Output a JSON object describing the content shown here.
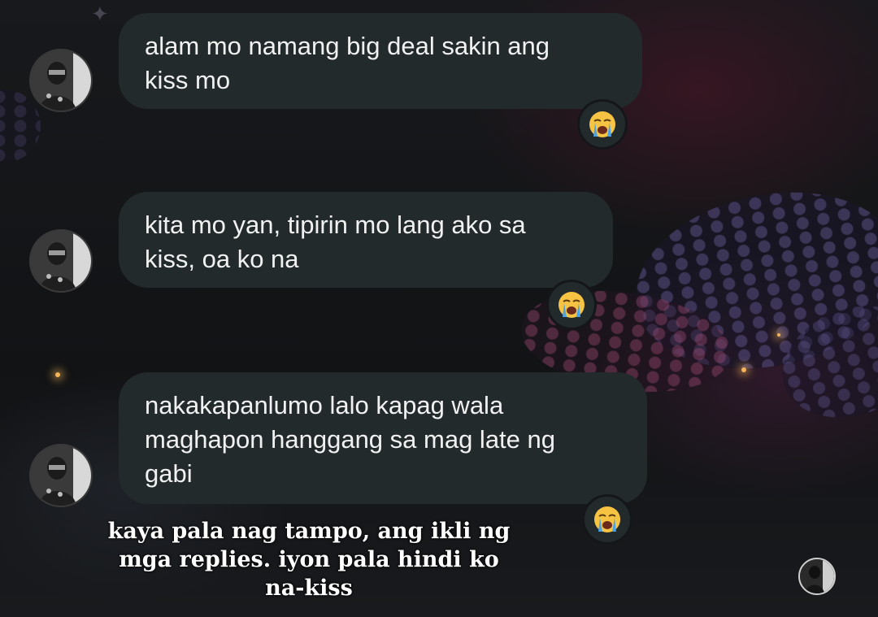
{
  "messages": [
    {
      "text": "alam mo namang big deal sakin ang\nkiss mo",
      "reaction": "loudly-crying-face"
    },
    {
      "text": "kita mo yan, tipirin mo lang ako sa\nkiss, oa ko na",
      "reaction": "loudly-crying-face"
    },
    {
      "text": "nakakapanlumo lalo kapag wala\nmaghapon hanggang sa mag late ng\ngabi",
      "reaction": "loudly-crying-face"
    }
  ],
  "caption": {
    "line1": "kaya pala nag tampo, ang ikli ng",
    "line2": "mga replies. iyon pala hindi ko",
    "line3": "na-kiss"
  },
  "colors": {
    "bubble": "#232a2c",
    "text": "#f1f1f1",
    "background": "#14161a",
    "emoji_face": "#f6c343",
    "emoji_tears": "#4aa3e8"
  }
}
